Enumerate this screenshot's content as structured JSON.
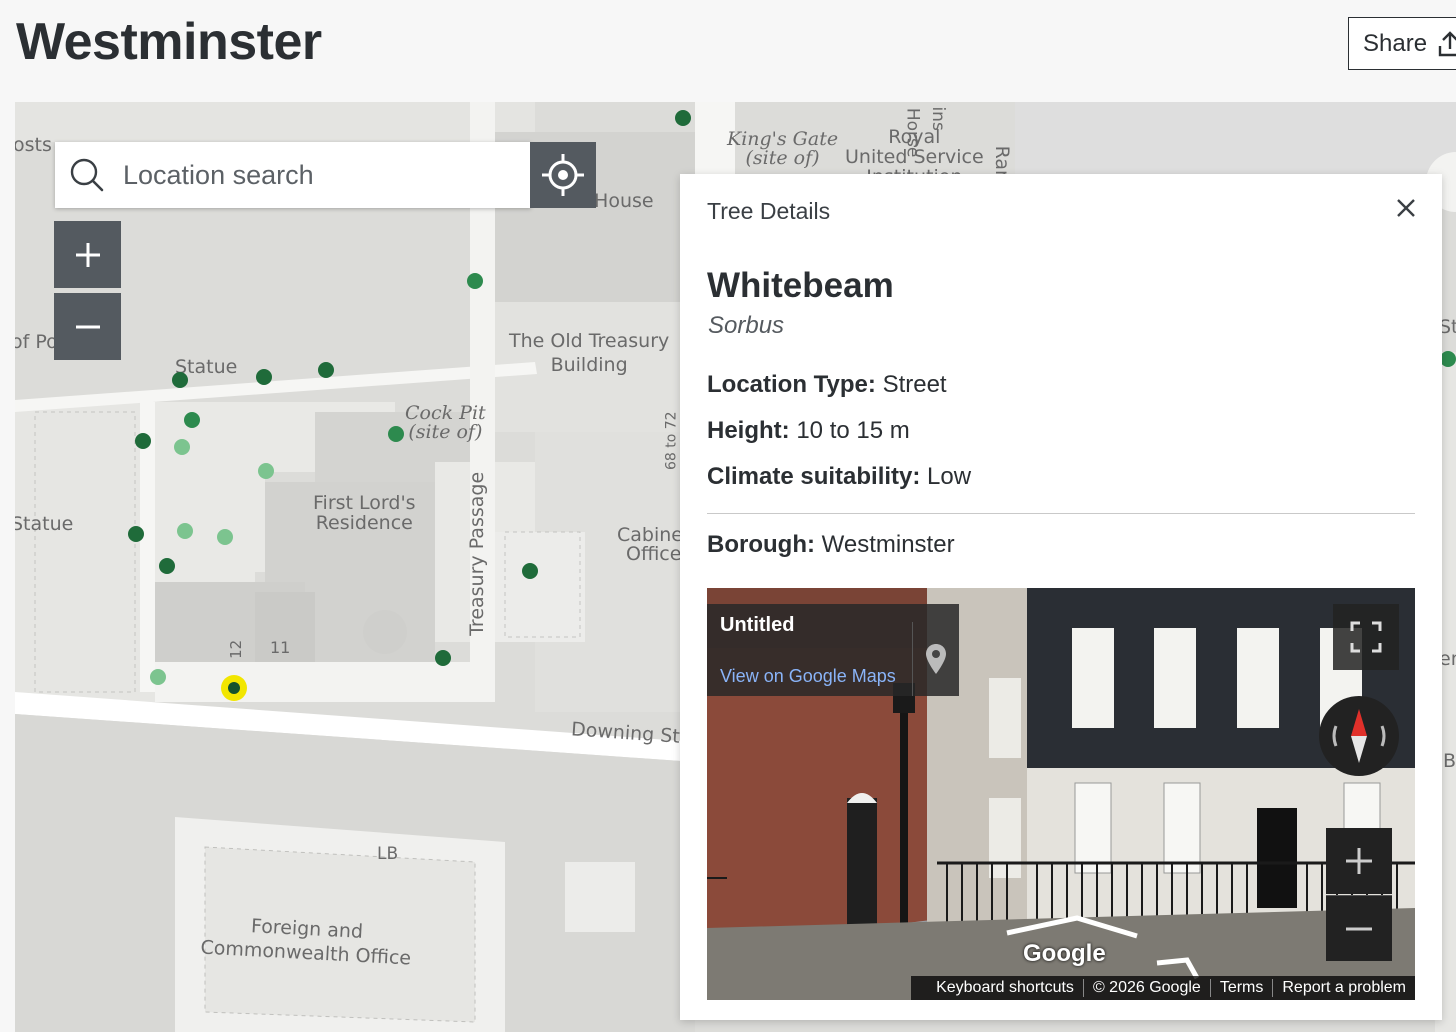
{
  "page": {
    "title": "Westminster",
    "share_label": "Share"
  },
  "search": {
    "placeholder": "Location search"
  },
  "map": {
    "labels": {
      "posts": "osts",
      "of_po": "of Po",
      "statue_1": "Statue",
      "statue_2": "Statue",
      "old_treasury_1": "The Old Treasury",
      "old_treasury_2": "Building",
      "cock_pit_1": "Cock Pit",
      "cock_pit_2": "(site of)",
      "first_lord_1": "First Lord's",
      "first_lord_2": "Residence",
      "treasury_passage": "Treasury Passage",
      "cabinet_1": "Cabinet",
      "cabinet_2": "Office",
      "dover_house": "Dover House",
      "kings_gate_1": "King's Gate",
      "kings_gate_2": "(site of)",
      "royal_1": "Royal",
      "royal_2": "United Service",
      "royal_3": "Institution",
      "horse": "Horse",
      "num_68_72": "68 to 72",
      "num_12": "12",
      "num_11": "11",
      "downing_st": "Downing St",
      "lb": "LB",
      "foreign_1": "Foreign and",
      "foreign_2": "Commonwealth Office",
      "st_right": "St",
      "ran": "Ran",
      "ins": "ins",
      "en_right": "en",
      "b_right": "B"
    },
    "tree_colors": {
      "dark": "#1f6b3a",
      "medium": "#2d8a4e",
      "light": "#7cc48f",
      "selected_ring": "#f2e600",
      "selected_core": "#14532d"
    }
  },
  "tree_details": {
    "header": "Tree Details",
    "name": "Whitebeam",
    "latin": "Sorbus",
    "location_type_label": "Location Type:",
    "location_type_value": "Street",
    "height_label": "Height:",
    "height_value": "10 to 15 m",
    "climate_label": "Climate suitability:",
    "climate_value": "Low",
    "borough_label": "Borough:",
    "borough_value": "Westminster"
  },
  "street_view": {
    "title": "Untitled",
    "link": "View on Google Maps",
    "logo": "Google",
    "footer": [
      "Keyboard shortcuts",
      "© 2026 Google",
      "Terms",
      "Report a problem"
    ]
  }
}
